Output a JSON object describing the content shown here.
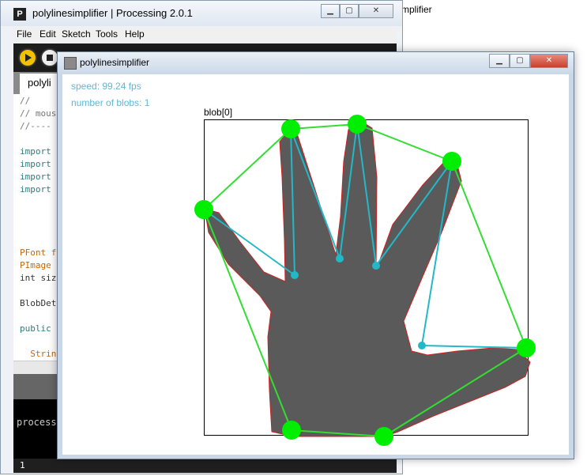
{
  "ide": {
    "app_icon_letter": "P",
    "title": "polylinesimplifier | Processing 2.0.1",
    "menu": [
      "File",
      "Edit",
      "Sketch",
      "Tools",
      "Help"
    ],
    "tab_label": "polyli",
    "code_lines": [
      {
        "text": "//",
        "color": "#777777"
      },
      {
        "text": "// mous",
        "color": "#777777"
      },
      {
        "text": "//----",
        "color": "#777777"
      },
      {
        "text": "",
        "color": "#000000"
      },
      {
        "text": "import",
        "color": "#2d7c79"
      },
      {
        "text": "import",
        "color": "#2d7c79"
      },
      {
        "text": "import",
        "color": "#2d7c79"
      },
      {
        "text": "import",
        "color": "#2d7c79"
      },
      {
        "text": "",
        "color": "#000000"
      },
      {
        "text": "",
        "color": "#000000"
      },
      {
        "text": "",
        "color": "#000000"
      },
      {
        "text": "",
        "color": "#000000"
      },
      {
        "text": "PFont f",
        "color": "#cc6600"
      },
      {
        "text": "PImage",
        "color": "#cc6600"
      },
      {
        "text": "int siz",
        "color": "#333333"
      },
      {
        "text": "",
        "color": "#000000"
      },
      {
        "text": "BlobDet",
        "color": "#333333"
      },
      {
        "text": "",
        "color": "#000000"
      },
      {
        "text": "public",
        "color": "#2d7c79"
      },
      {
        "text": "",
        "color": "#000000"
      },
      {
        "text": "  Strin",
        "color": "#cc6600"
      }
    ],
    "console_text": "process",
    "status_line": "1"
  },
  "background_ghost_text": "mplifier",
  "sketch": {
    "title": "polylinesimplifier",
    "speed_text": "speed:  99.24 fps",
    "blobs_text": "number of blobs: 1",
    "blob_label": "blob[0]"
  },
  "colors": {
    "hull_line": "#33dd33",
    "hull_node": "#00ee00",
    "finger_line": "#22b8c8",
    "stat_text": "#5fb7d4",
    "play_button": "#f2c200"
  },
  "icons": [
    "processing-app-icon",
    "play-icon",
    "stop-icon",
    "minimize-icon",
    "maximize-icon",
    "close-icon",
    "sketch-window-icon"
  ]
}
